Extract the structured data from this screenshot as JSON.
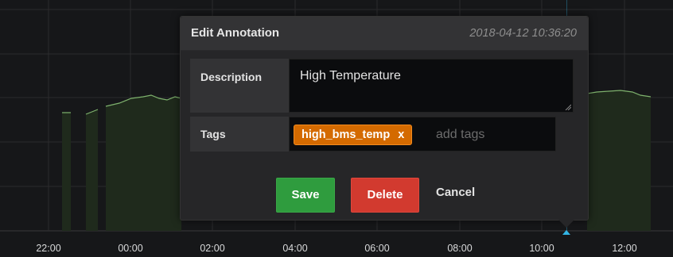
{
  "graph": {
    "x_ticks": [
      {
        "label": "22:00"
      },
      {
        "label": "00:00"
      },
      {
        "label": "02:00"
      },
      {
        "label": "04:00"
      },
      {
        "label": "06:00"
      },
      {
        "label": "08:00"
      },
      {
        "label": "10:00"
      },
      {
        "label": "12:00"
      }
    ],
    "series_color": "#7eb26d",
    "annotation_color": "#33b5e5"
  },
  "dialog": {
    "title": "Edit Annotation",
    "timestamp": "2018-04-12 10:36:20",
    "description": {
      "label": "Description",
      "value": "High Temperature"
    },
    "tags": {
      "label": "Tags",
      "items": [
        {
          "name": "high_bms_temp",
          "remove": "x"
        }
      ],
      "placeholder": "add tags"
    },
    "buttons": {
      "save": "Save",
      "delete": "Delete",
      "cancel": "Cancel"
    }
  }
}
